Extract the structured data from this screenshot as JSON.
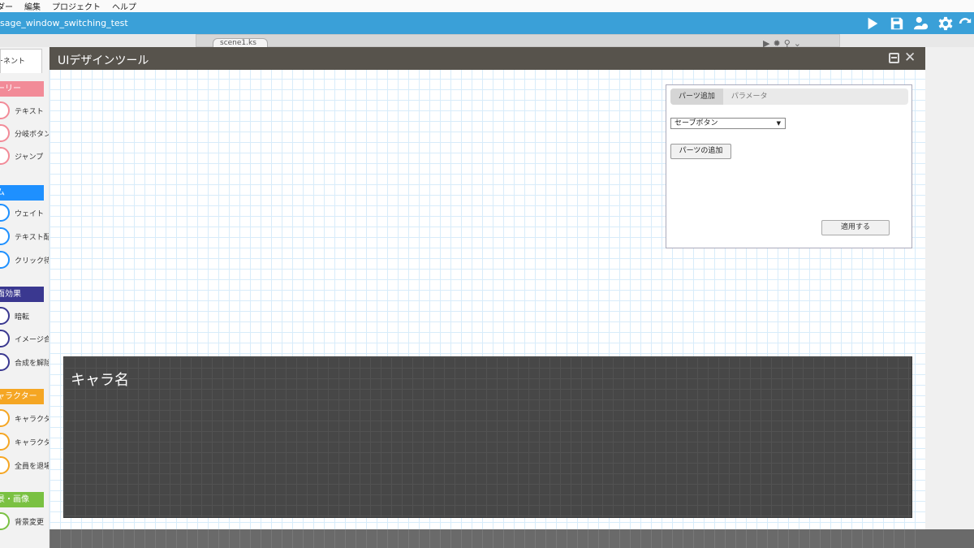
{
  "menu": [
    "ダー",
    "編集",
    "プロジェクト",
    "ヘルプ"
  ],
  "project_title": "sage_window_switching_test",
  "toolbar_icons": [
    "play-icon",
    "save-icon",
    "users-settings-icon",
    "gear-icon",
    "refresh-icon"
  ],
  "scene_tab": {
    "label": "scene1.ks"
  },
  "sidebar": {
    "tab_label": "ーネント",
    "categories": [
      {
        "title": "ーリー",
        "color": "#f28b98",
        "items": [
          "テキスト",
          "分岐ボタン",
          "ジャンプ"
        ]
      },
      {
        "title": "ム",
        "color": "#1e90ff",
        "items": [
          "ウェイト",
          "テキスト配置",
          "クリック待ち"
        ]
      },
      {
        "title": "面効果",
        "color": "#3a3890",
        "items": [
          "暗転",
          "イメージ合成",
          "合成を解除"
        ]
      },
      {
        "title": "ャラクター",
        "color": "#f5a623",
        "items": [
          "キャラクター",
          "キャラクター",
          "全員を退場"
        ]
      },
      {
        "title": "景・画像",
        "color": "#7ac142",
        "items": [
          "背景変更"
        ]
      }
    ]
  },
  "modal": {
    "title": "UIデザインツール",
    "tabs": [
      "パーツ追加",
      "パラメータ"
    ],
    "parts_select_value": "セーブボタン",
    "add_part_button": "パーツの追加",
    "apply_button": "適用する",
    "message_window": {
      "character_name": "キャラ名"
    }
  }
}
